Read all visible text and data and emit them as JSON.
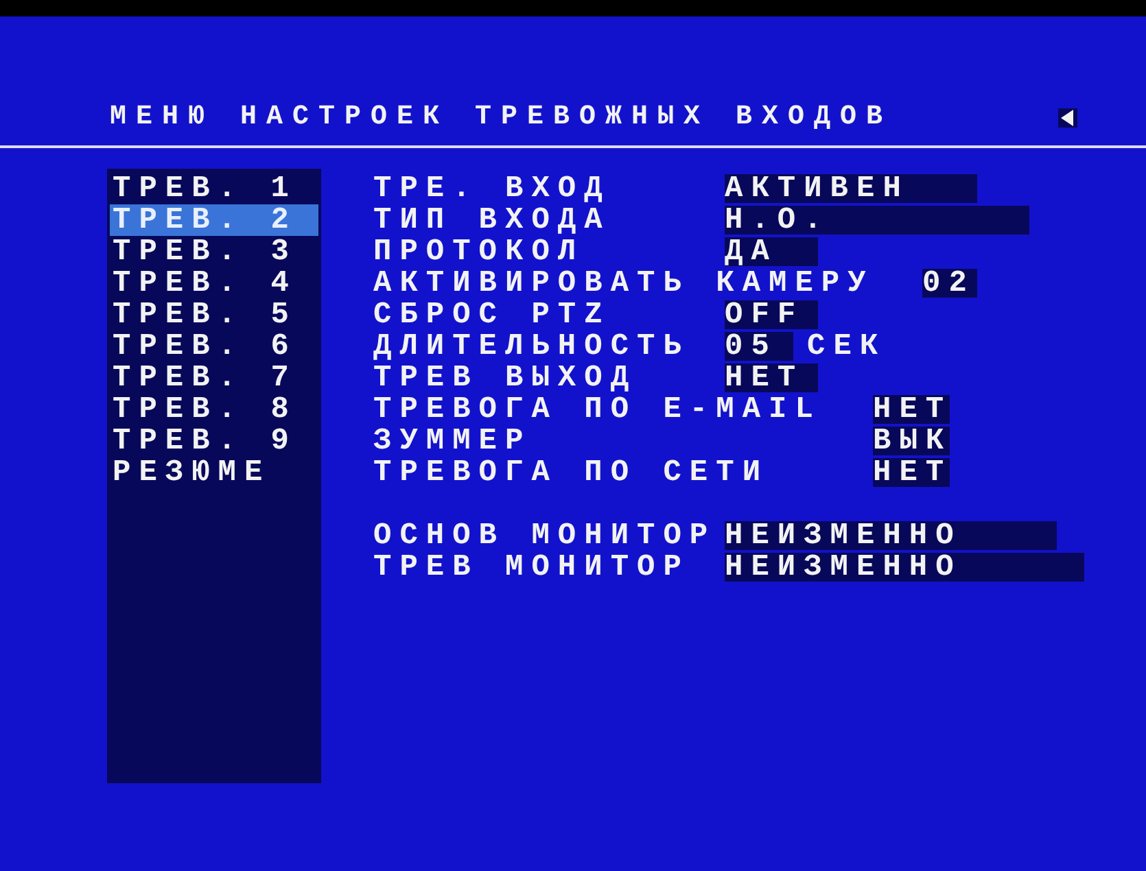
{
  "title": "МЕНЮ НАСТРОЕК ТРЕВОЖНЫХ ВХОДОВ",
  "alarms": [
    {
      "label": "ТРЕВ. 1",
      "selected": false
    },
    {
      "label": "ТРЕВ. 2",
      "selected": true
    },
    {
      "label": "ТРЕВ. 3",
      "selected": false
    },
    {
      "label": "ТРЕВ. 4",
      "selected": false
    },
    {
      "label": "ТРЕВ. 5",
      "selected": false
    },
    {
      "label": "ТРЕВ. 6",
      "selected": false
    },
    {
      "label": "ТРЕВ. 7",
      "selected": false
    },
    {
      "label": "ТРЕВ. 8",
      "selected": false
    },
    {
      "label": "ТРЕВ. 9",
      "selected": false
    },
    {
      "label": "РЕЗЮМЕ",
      "selected": false
    }
  ],
  "settings": [
    {
      "label": "ТРЕ. ВХОД",
      "value": "АКТИВЕН"
    },
    {
      "label": "ТИП ВХОДА",
      "value": "Н.О."
    },
    {
      "label": "ПРОТОКОЛ",
      "value": "ДА"
    },
    {
      "label": "АКТИВИРОВАТЬ КАМЕРУ",
      "value": "02"
    },
    {
      "label": "СБРОС PTZ",
      "value": "OFF"
    },
    {
      "label": "ДЛИТЕЛЬНОСТЬ",
      "value": "05",
      "unit": "СЕК"
    },
    {
      "label": "ТРЕВ ВЫХОД",
      "value": "НЕТ"
    },
    {
      "label": "ТРЕВОГА ПО E-MAIL",
      "value": "НЕТ"
    },
    {
      "label": "ЗУММЕР",
      "value": "ВЫК"
    },
    {
      "label": "ТРЕВОГА ПО СЕТИ",
      "value": "НЕТ"
    }
  ],
  "monitors": [
    {
      "label": "ОСНОВ МОНИТОР",
      "value": "НЕИЗМЕННО"
    },
    {
      "label": "ТРЕВ МОНИТОР",
      "value": "НЕИЗМЕННО"
    }
  ]
}
